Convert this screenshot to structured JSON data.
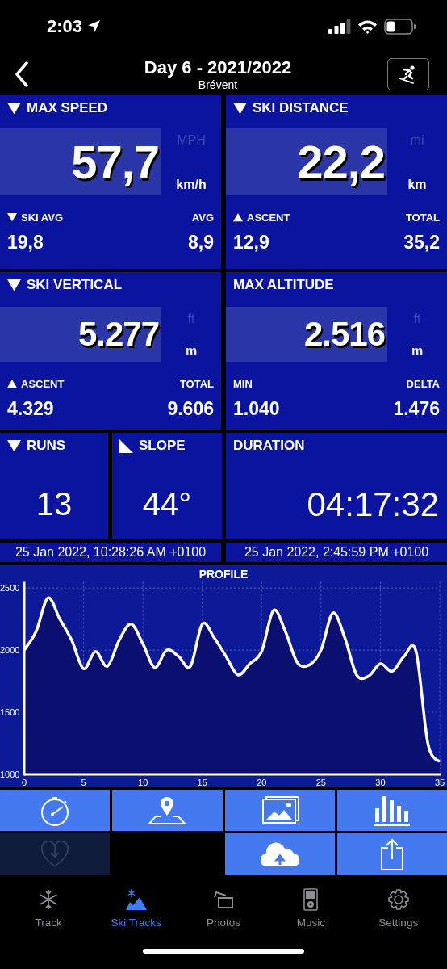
{
  "status_bar": {
    "time": "2:03"
  },
  "header": {
    "title": "Day 6 - 2021/2022",
    "subtitle": "Brévent"
  },
  "stats": [
    {
      "kind": "down",
      "label": "MAX SPEED",
      "value": "57,7",
      "alt_unit": "MPH",
      "unit": "km/h",
      "sub_left": {
        "kind": "down",
        "label": "SKI AVG",
        "value": "19,8"
      },
      "sub_right": {
        "label": "AVG",
        "value": "8,9"
      }
    },
    {
      "kind": "down",
      "label": "SKI DISTANCE",
      "value": "22,2",
      "alt_unit": "mi",
      "unit": "km",
      "sub_left": {
        "kind": "up",
        "label": "ASCENT",
        "value": "12,9"
      },
      "sub_right": {
        "label": "TOTAL",
        "value": "35,2"
      }
    },
    {
      "kind": "down",
      "label": "SKI VERTICAL",
      "value": "5.277",
      "alt_unit": "ft",
      "unit": "m",
      "sub_left": {
        "kind": "up",
        "label": "ASCENT",
        "value": "4.329"
      },
      "sub_right": {
        "label": "TOTAL",
        "value": "9.606"
      }
    },
    {
      "kind": "none",
      "label": "MAX ALTITUDE",
      "value": "2.516",
      "alt_unit": "ft",
      "unit": "m",
      "sub_left": {
        "kind": "none",
        "label": "MIN",
        "value": "1.040"
      },
      "sub_right": {
        "label": "DELTA",
        "value": "1.476"
      }
    }
  ],
  "small_stats": [
    {
      "kind": "down",
      "label": "RUNS",
      "value": "13"
    },
    {
      "kind": "slope",
      "label": "SLOPE",
      "value": "44°"
    },
    {
      "kind": "none",
      "label": "DURATION",
      "value": "04:17:32"
    }
  ],
  "times": [
    "25 Jan 2022, 10:28:26 AM +0100",
    "25 Jan 2022, 2:45:59 PM +0100"
  ],
  "profile": {
    "chart_data": {
      "type": "area",
      "title": "PROFILE",
      "x": [
        0,
        1,
        2,
        3,
        4,
        5,
        6,
        7,
        8,
        9,
        10,
        11,
        12,
        13,
        14,
        15,
        16,
        17,
        18,
        19,
        20,
        21,
        22,
        23,
        24,
        25,
        26,
        27,
        28,
        29,
        30,
        31,
        32,
        33,
        34,
        35
      ],
      "grid": true,
      "series": [
        {
          "color": "#ffffff",
          "values": [
            2000,
            2150,
            2420,
            2250,
            2080,
            1850,
            1990,
            1870,
            2080,
            2210,
            2050,
            1860,
            2000,
            1950,
            1870,
            2210,
            2100,
            1950,
            1800,
            1890,
            1990,
            2320,
            2150,
            1900,
            1880,
            2000,
            2300,
            2100,
            1800,
            1790,
            1890,
            1830,
            1950,
            1990,
            1250,
            1100
          ]
        }
      ],
      "xlim": [
        0,
        35
      ],
      "ylim": [
        1000,
        2550
      ],
      "xticks": [
        0,
        5,
        10,
        15,
        20,
        25,
        30,
        35
      ],
      "yticks": [
        1000,
        1500,
        2000,
        2500
      ]
    }
  },
  "actions": [
    {
      "kind": "stopwatch",
      "disabled": false
    },
    {
      "kind": "map",
      "disabled": false
    },
    {
      "kind": "photos",
      "disabled": false
    },
    {
      "kind": "bars",
      "disabled": false
    },
    {
      "kind": "heart",
      "disabled": true
    },
    {
      "kind": "cloud",
      "disabled": false
    },
    {
      "kind": "share",
      "disabled": false
    }
  ],
  "tabs": [
    {
      "kind": "snowflake",
      "label": "Track",
      "selected": false
    },
    {
      "kind": "mountain",
      "label": "Ski Tracks",
      "selected": true
    },
    {
      "kind": "photos",
      "label": "Photos",
      "selected": false
    },
    {
      "kind": "player",
      "label": "Music",
      "selected": false
    },
    {
      "kind": "gear",
      "label": "Settings",
      "selected": false
    }
  ]
}
